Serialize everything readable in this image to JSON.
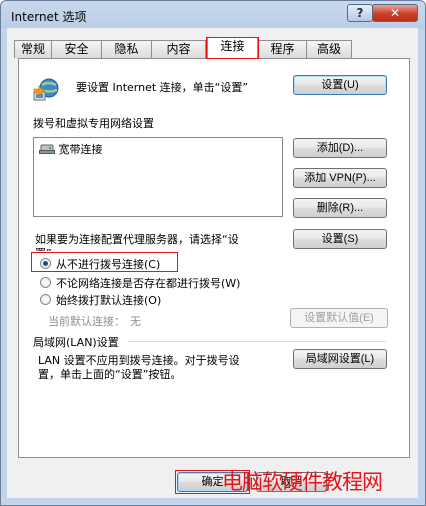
{
  "window": {
    "title": "Internet 选项",
    "help_label": "?",
    "close_label": "✕"
  },
  "tabs": [
    "常规",
    "安全",
    "隐私",
    "内容",
    "连接",
    "程序",
    "高级"
  ],
  "active_tab": "连接",
  "setup": {
    "text": "要设置 Internet 连接，单击“设置”",
    "button": "设置(U)",
    "icon": "globe-network-icon"
  },
  "dialup": {
    "heading": "拨号和虚拟专用网络设置",
    "items": [
      "宽带连接"
    ],
    "item_icon": "connection-icon",
    "add_button": "添加(D)...",
    "add_vpn_button": "添加 VPN(P)...",
    "remove_button": "删除(R)...",
    "proxy_text_line1": "如果要为连接配置代理服务器，请选择“设",
    "proxy_text_line2": "置”。",
    "settings_button": "设置(S)",
    "options": [
      "从不进行拨号连接(C)",
      "不论网络连接是否存在都进行拨号(W)",
      "始终拨打默认连接(O)"
    ],
    "selected_option": 0,
    "current_default_label": "当前默认连接：",
    "current_default_value": "无",
    "set_default_button": "设置默认值(E)"
  },
  "lan": {
    "heading": "局域网(LAN)设置",
    "text_line1": "LAN 设置不应用到拨号连接。对于拨号设",
    "text_line2": "置，单击上面的“设置”按钮。",
    "button": "局域网设置(L)"
  },
  "footer": {
    "ok_button": "确定",
    "cancel_button": "取消"
  },
  "watermark": "电脑软硬件教程网",
  "colors": {
    "highlight_box": "#ee1111",
    "watermark": "#e8141a"
  }
}
